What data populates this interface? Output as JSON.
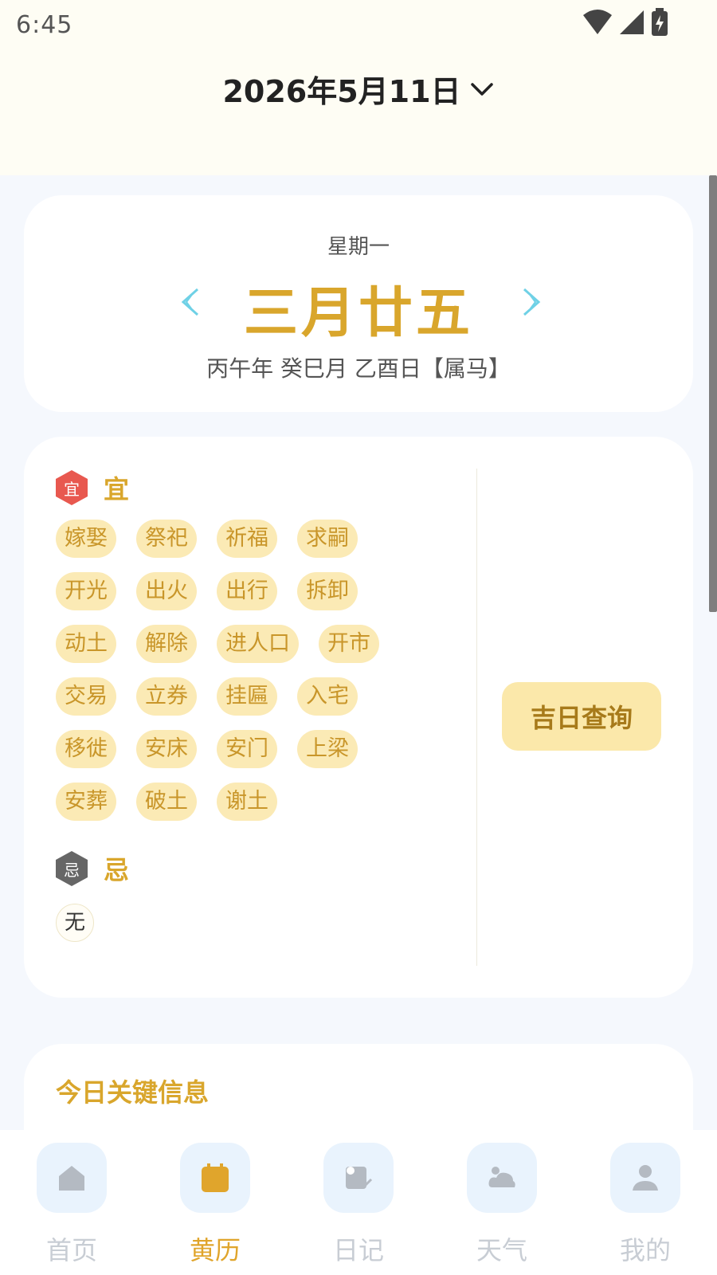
{
  "status_bar": {
    "time": "6:45"
  },
  "header": {
    "date": "2026年5月11日"
  },
  "date_card": {
    "weekday": "星期一",
    "lunar_date": "三月廿五",
    "ganzhi": "丙午年 癸巳月 乙酉日【属马】"
  },
  "yi": {
    "badge": "宜",
    "title": "宜",
    "items": [
      "嫁娶",
      "祭祀",
      "祈福",
      "求嗣",
      "开光",
      "出火",
      "出行",
      "拆卸",
      "动土",
      "解除",
      "进人口",
      "开市",
      "交易",
      "立券",
      "挂匾",
      "入宅",
      "移徙",
      "安床",
      "安门",
      "上梁",
      "安葬",
      "破土",
      "谢土"
    ]
  },
  "ji": {
    "badge": "忌",
    "title": "忌",
    "items": [
      "无"
    ]
  },
  "jiri_button": "吉日查询",
  "key_info": {
    "title": "今日关键信息"
  },
  "tabs": [
    {
      "label": "首页",
      "icon": "home-icon"
    },
    {
      "label": "黄历",
      "icon": "calendar-icon",
      "active": true
    },
    {
      "label": "日记",
      "icon": "diary-icon"
    },
    {
      "label": "天气",
      "icon": "weather-icon"
    },
    {
      "label": "我的",
      "icon": "profile-icon"
    }
  ],
  "colors": {
    "accent": "#d9a62c",
    "tag_bg": "#fbeab5",
    "yi_badge": "#e8584f",
    "ji_badge": "#666666",
    "header_bg": "#fefdf4",
    "page_bg": "#f5f8fd"
  }
}
